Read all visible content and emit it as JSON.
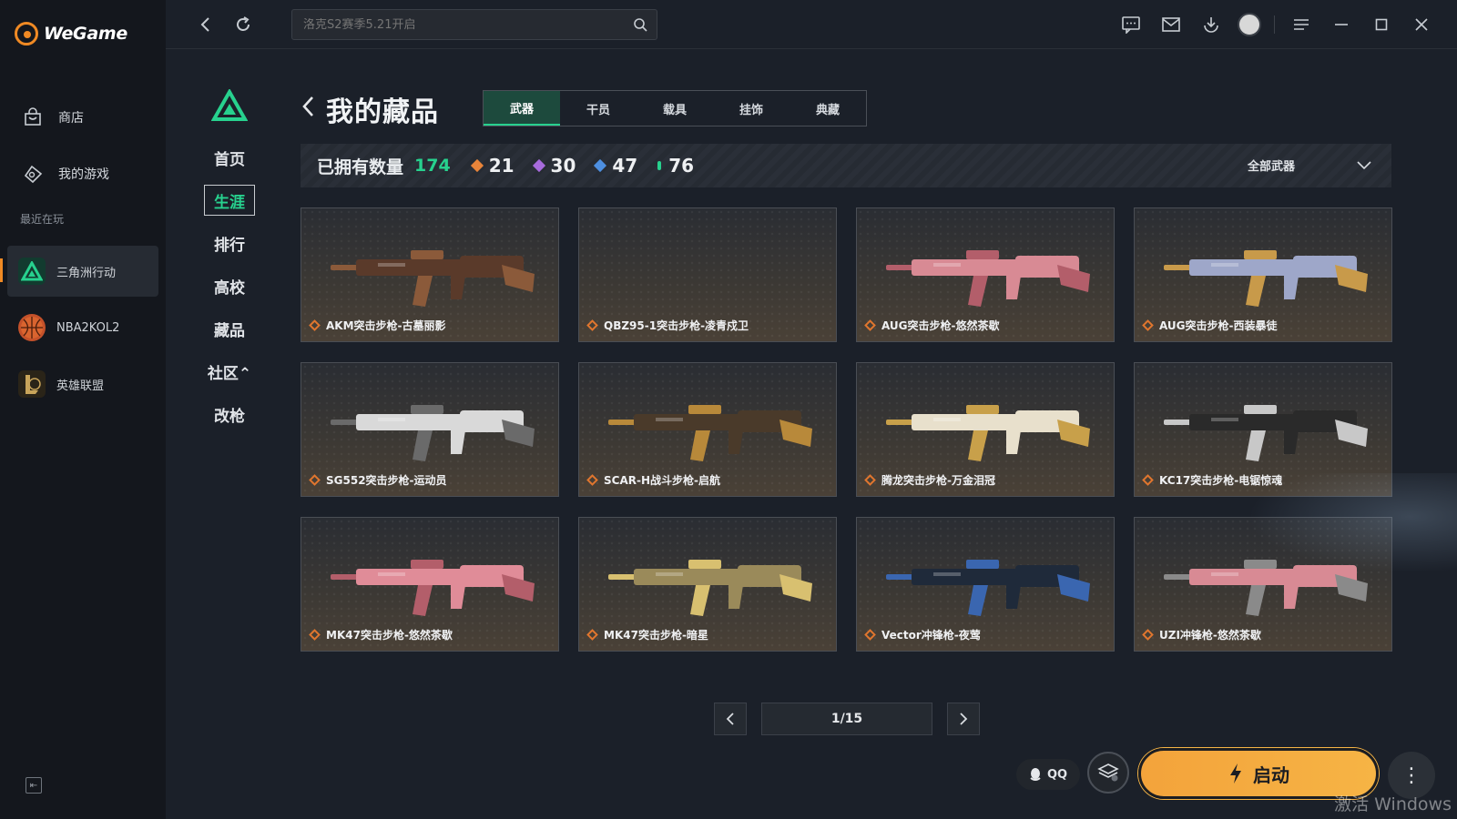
{
  "app": {
    "name": "WeGame"
  },
  "sidebar": {
    "items": [
      {
        "label": "商店",
        "icon": "store-bag-icon"
      },
      {
        "label": "我的游戏",
        "icon": "gamepad-icon"
      }
    ],
    "recent_label": "最近在玩",
    "recent": [
      {
        "label": "三角洲行动",
        "active": true
      },
      {
        "label": "NBA2KOL2",
        "active": false
      },
      {
        "label": "英雄联盟",
        "active": false
      }
    ]
  },
  "topbar": {
    "search_placeholder": "洛克S2赛季5.21开启"
  },
  "game_nav": {
    "items": [
      {
        "label": "首页"
      },
      {
        "label": "生涯",
        "active": true
      },
      {
        "label": "排行"
      },
      {
        "label": "高校"
      },
      {
        "label": "藏品"
      },
      {
        "label": "社区⌃"
      },
      {
        "label": "改枪"
      }
    ]
  },
  "page": {
    "title": "我的藏品",
    "tabs": [
      "武器",
      "干员",
      "载具",
      "挂饰",
      "典藏"
    ],
    "active_tab": 0
  },
  "stats": {
    "label": "已拥有数量",
    "total": "174",
    "rarities": [
      {
        "value": "21",
        "color": "#e8843a"
      },
      {
        "value": "30",
        "color": "#a76bdc"
      },
      {
        "value": "47",
        "color": "#4d8fe0"
      },
      {
        "value": "76",
        "color": "#27d18e"
      }
    ],
    "filter": "全部武器"
  },
  "items": [
    {
      "name": "AKM突击步枪-古墓丽影",
      "body": "#5a3a2a",
      "accent": "#8b5a3a"
    },
    {
      "name": "QBZ95-1突击步枪-凌青戍卫",
      "body": "",
      "accent": ""
    },
    {
      "name": "AUG突击步枪-悠然茶歇",
      "body": "#d88a94",
      "accent": "#b35e6a"
    },
    {
      "name": "AUG突击步枪-西装暴徒",
      "body": "#9ea7c9",
      "accent": "#c89a4a"
    },
    {
      "name": "SG552突击步枪-运动员",
      "body": "#d9d9d9",
      "accent": "#6a6a6a"
    },
    {
      "name": "SCAR-H战斗步枪-启航",
      "body": "#4a3a2a",
      "accent": "#b8893a"
    },
    {
      "name": "腾龙突击步枪-万金泪冠",
      "body": "#e8e0cc",
      "accent": "#c8a04a"
    },
    {
      "name": "KC17突击步枪-电锯惊魂",
      "body": "#2a2a2a",
      "accent": "#c8c8c8"
    },
    {
      "name": "MK47突击步枪-悠然茶歇",
      "body": "#e08c98",
      "accent": "#b35e6a"
    },
    {
      "name": "MK47突击步枪-暗星",
      "body": "#9a8a5a",
      "accent": "#d8c070"
    },
    {
      "name": "Vector冲锋枪-夜莺",
      "body": "#1f2a3a",
      "accent": "#3a66b0"
    },
    {
      "name": "UZI冲锋枪-悠然茶歇",
      "body": "#d88a94",
      "accent": "#8a8a8a"
    }
  ],
  "pagination": {
    "page_text": "1/15"
  },
  "footer": {
    "qq_label": "QQ",
    "launch_label": "启动",
    "watermark": "激活 Windows"
  },
  "colors": {
    "accent_green": "#27d18e",
    "launch_orange": "#f3a33b",
    "brand_orange": "#f08a24"
  }
}
